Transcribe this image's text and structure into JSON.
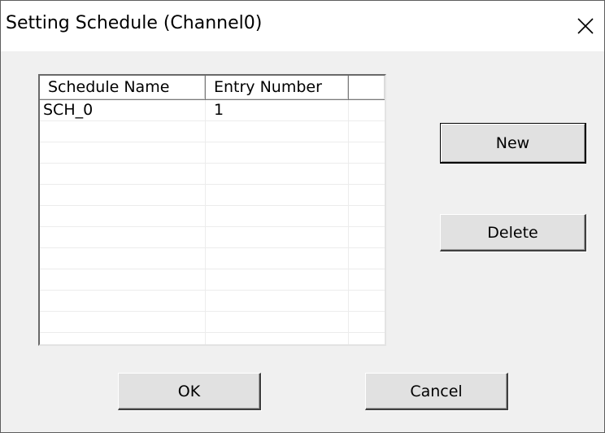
{
  "window": {
    "title": "Setting Schedule (Channel0)"
  },
  "list": {
    "columns": [
      "Schedule Name",
      "Entry Number",
      ""
    ],
    "rows": [
      [
        "SCH_0",
        "1",
        ""
      ],
      [
        "",
        "",
        ""
      ],
      [
        "",
        "",
        ""
      ],
      [
        "",
        "",
        ""
      ],
      [
        "",
        "",
        ""
      ],
      [
        "",
        "",
        ""
      ],
      [
        "",
        "",
        ""
      ],
      [
        "",
        "",
        ""
      ],
      [
        "",
        "",
        ""
      ],
      [
        "",
        "",
        ""
      ],
      [
        "",
        "",
        ""
      ],
      [
        "",
        "",
        ""
      ]
    ]
  },
  "buttons": {
    "new": "New",
    "delete": "Delete",
    "ok": "OK",
    "cancel": "Cancel"
  },
  "icons": {
    "close": "close-icon"
  }
}
